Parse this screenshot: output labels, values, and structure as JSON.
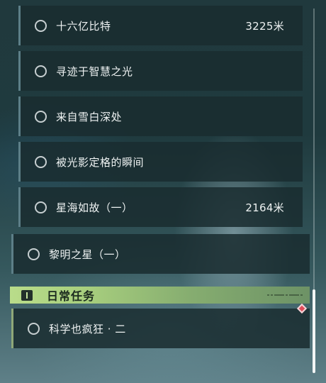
{
  "quests": [
    {
      "name": "十六亿比特",
      "distance": "3225米"
    },
    {
      "name": "寻迹于智慧之光",
      "distance": ""
    },
    {
      "name": "来自雪白深处",
      "distance": ""
    },
    {
      "name": "被光影定格的瞬间",
      "distance": ""
    },
    {
      "name": "星海如故（一）",
      "distance": "2164米"
    },
    {
      "name": "黎明之星（一）",
      "distance": ""
    }
  ],
  "daily_section": {
    "title": "日常任务",
    "icon": "alert-icon",
    "accent_color": "#b9dc8a",
    "quests": [
      {
        "name": "科学也疯狂 · 二",
        "distance": "",
        "marker": "red-diamond-icon"
      }
    ]
  },
  "colors": {
    "row_background": "#1a2c30",
    "row_accent": "#5d7f88",
    "marker": "#e04c5a"
  }
}
